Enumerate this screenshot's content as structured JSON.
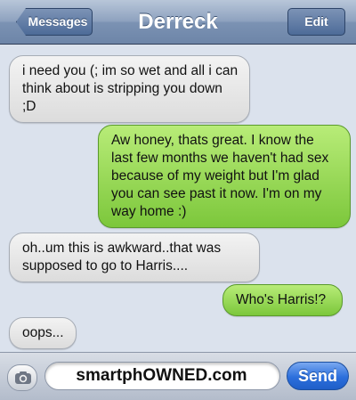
{
  "nav": {
    "back_label": "Messages",
    "title": "Derreck",
    "edit_label": "Edit"
  },
  "messages": [
    {
      "side": "received",
      "text": "i need you (; im so wet and all i can think about is stripping you down ;D"
    },
    {
      "side": "sent",
      "text": "Aw honey, thats great. I know the last few months we haven't had sex because of my weight but I'm glad you can see past it now. I'm on my way home :)"
    },
    {
      "side": "received",
      "text": "oh..um this is awkward..that was supposed to go to Harris...."
    },
    {
      "side": "sent",
      "text": "Who's Harris!?"
    },
    {
      "side": "received",
      "text": "oops..."
    }
  ],
  "composer": {
    "camera_icon": "camera-icon",
    "field_value": "smartphOWNED.com",
    "send_label": "Send"
  },
  "colors": {
    "sent_bubble": "#8fd34a",
    "received_bubble": "#e6e6e6",
    "background": "#dbe2ed",
    "send_button": "#2c6fdc"
  }
}
